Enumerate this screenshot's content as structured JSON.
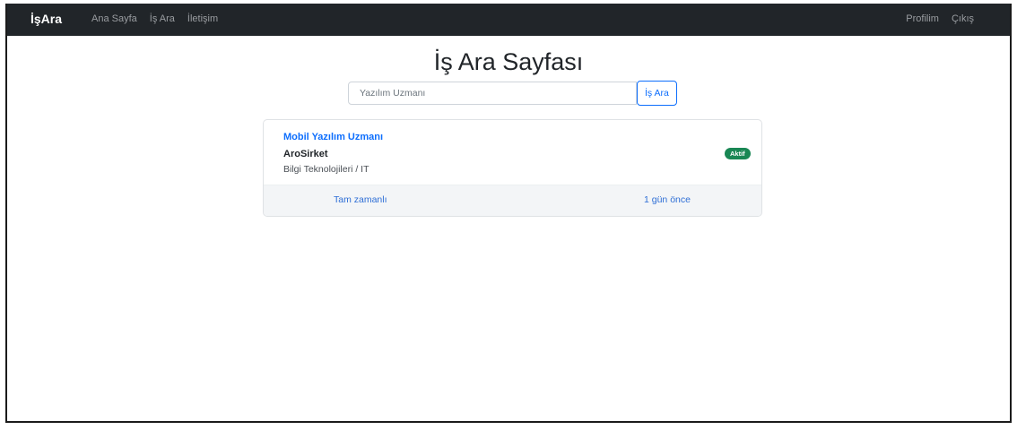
{
  "navbar": {
    "brand": "İşAra",
    "links": [
      "Ana Sayfa",
      "İş Ara",
      "İletişim"
    ],
    "right_links": [
      "Profilim",
      "Çıkış"
    ]
  },
  "page": {
    "title": "İş Ara Sayfası"
  },
  "search": {
    "value": "",
    "placeholder": "Yazılım Uzmanı",
    "button_label": "İş Ara"
  },
  "jobs": [
    {
      "title": "Mobil Yazılım Uzmanı",
      "company": "AroSirket",
      "sector": "Bilgi Teknolojileri / IT",
      "status": "Aktif",
      "type": "Tam zamanlı",
      "posted": "1 gün önce"
    }
  ],
  "colors": {
    "navbar_bg": "#212529",
    "accent": "#0d6efd",
    "status_active": "#198754"
  }
}
